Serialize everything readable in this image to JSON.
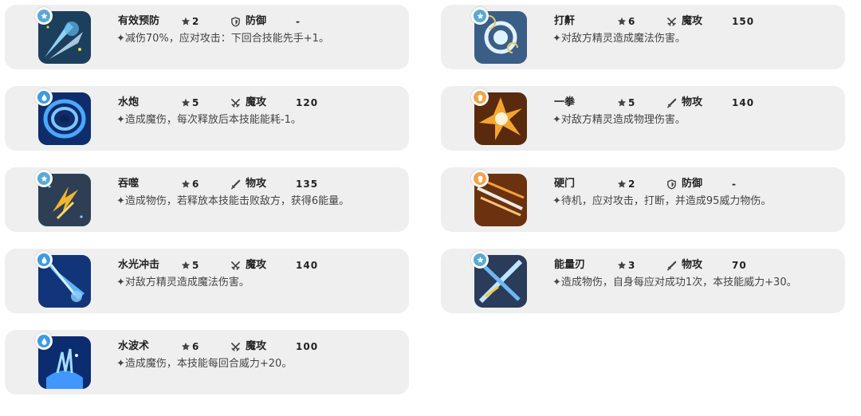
{
  "skills": [
    {
      "name": "有效预防",
      "cost": "2",
      "type": "防御",
      "type_icon": "shield-icon",
      "power": "-",
      "desc": "✦减伤70%，应对攻击：下回合技能先手+1。",
      "element": "normal",
      "art": "defense-burst"
    },
    {
      "name": "打鼾",
      "cost": "6",
      "type": "魔攻",
      "type_icon": "crossed-swords-icon",
      "power": "150",
      "desc": "✦对敌方精灵造成魔法伤害。",
      "element": "normal",
      "art": "swirl"
    },
    {
      "name": "水炮",
      "cost": "5",
      "type": "魔攻",
      "type_icon": "crossed-swords-icon",
      "power": "120",
      "desc": "✦造成魔伤，每次释放后本技能能耗-1。",
      "element": "water",
      "art": "water-rings"
    },
    {
      "name": "一拳",
      "cost": "5",
      "type": "物攻",
      "type_icon": "sword-icon",
      "power": "140",
      "desc": "✦对敌方精灵造成物理伤害。",
      "element": "fighting",
      "art": "punch-burst"
    },
    {
      "name": "吞噬",
      "cost": "6",
      "type": "物攻",
      "type_icon": "sword-icon",
      "power": "135",
      "desc": "✦造成物伤，若释放本技能击败敌方，获得6能量。",
      "element": "normal",
      "art": "claw"
    },
    {
      "name": "硬门",
      "cost": "2",
      "type": "防御",
      "type_icon": "shield-icon",
      "power": "-",
      "desc": "✦待机，应对攻击，打断，并造成95威力物伤。",
      "element": "fighting",
      "art": "slash-streaks"
    },
    {
      "name": "水光冲击",
      "cost": "5",
      "type": "魔攻",
      "type_icon": "crossed-swords-icon",
      "power": "140",
      "desc": "✦对敌方精灵造成魔法伤害。",
      "element": "water",
      "art": "water-beam"
    },
    {
      "name": "能量刃",
      "cost": "3",
      "type": "物攻",
      "type_icon": "sword-icon",
      "power": "70",
      "desc": "✦造成物伤，自身每应对成功1次，本技能威力+30。",
      "element": "normal",
      "art": "energy-blade"
    },
    {
      "name": "水波术",
      "cost": "6",
      "type": "魔攻",
      "type_icon": "crossed-swords-icon",
      "power": "100",
      "desc": "✦造成魔伤，本技能每回合威力+20。",
      "element": "water",
      "art": "water-splash"
    }
  ],
  "element_colors": {
    "normal": "#5aa9d6",
    "water": "#3f9be0",
    "fighting": "#f0a44a"
  }
}
